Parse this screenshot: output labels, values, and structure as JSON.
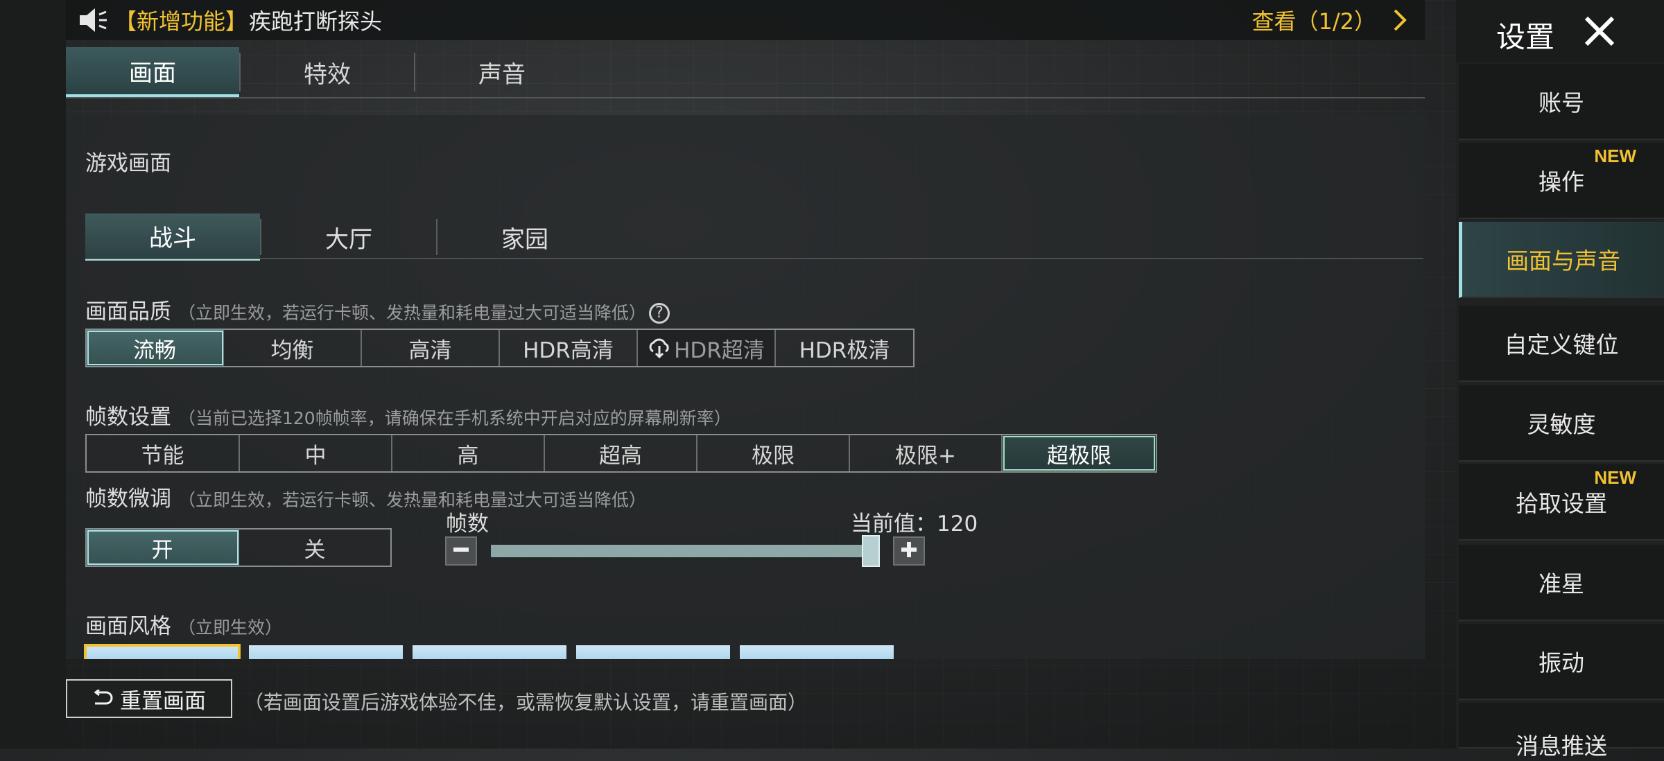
{
  "notice": {
    "tag": "【新增功能】",
    "text": "疾跑打断探头",
    "view": "查看（1/2）"
  },
  "top_tabs": [
    "画面",
    "特效",
    "声音"
  ],
  "section_title": "游戏画面",
  "sub_tabs": [
    "战斗",
    "大厅",
    "家园"
  ],
  "quality": {
    "label": "画面品质",
    "hint": "（立即生效，若运行卡顿、发热量和耗电量过大可适当降低）",
    "options": [
      "流畅",
      "均衡",
      "高清",
      "HDR高清",
      "HDR超清",
      "HDR极清"
    ],
    "selected": "流畅"
  },
  "fps": {
    "label": "帧数设置",
    "hint": "（当前已选择120帧帧率，请确保在手机系统中开启对应的屏幕刷新率）",
    "options": [
      "节能",
      "中",
      "高",
      "超高",
      "极限",
      "极限+",
      "超极限"
    ],
    "selected": "超极限"
  },
  "fine_tune": {
    "label": "帧数微调",
    "hint": "（立即生效，若运行卡顿、发热量和耗电量过大可适当降低）",
    "on": "开",
    "off": "关",
    "slider_label": "帧数",
    "current_value": "当前值：120"
  },
  "style": {
    "label": "画面风格",
    "hint": "（立即生效）"
  },
  "reset": {
    "button": "重置画面",
    "hint": "（若画面设置后游戏体验不佳，或需恢复默认设置，请重置画面）"
  },
  "sidebar": {
    "title": "设置",
    "items": [
      {
        "label": "账号"
      },
      {
        "label": "操作",
        "badge": "NEW"
      },
      {
        "label": "画面与声音"
      },
      {
        "label": "自定义键位"
      },
      {
        "label": "灵敏度"
      },
      {
        "label": "拾取设置",
        "badge": "NEW"
      },
      {
        "label": "准星"
      },
      {
        "label": "振动"
      },
      {
        "label": "消息推送"
      }
    ]
  },
  "colors": {
    "accent_yellow": "#f1c232",
    "accent_cyan": "#9fe0e3"
  }
}
